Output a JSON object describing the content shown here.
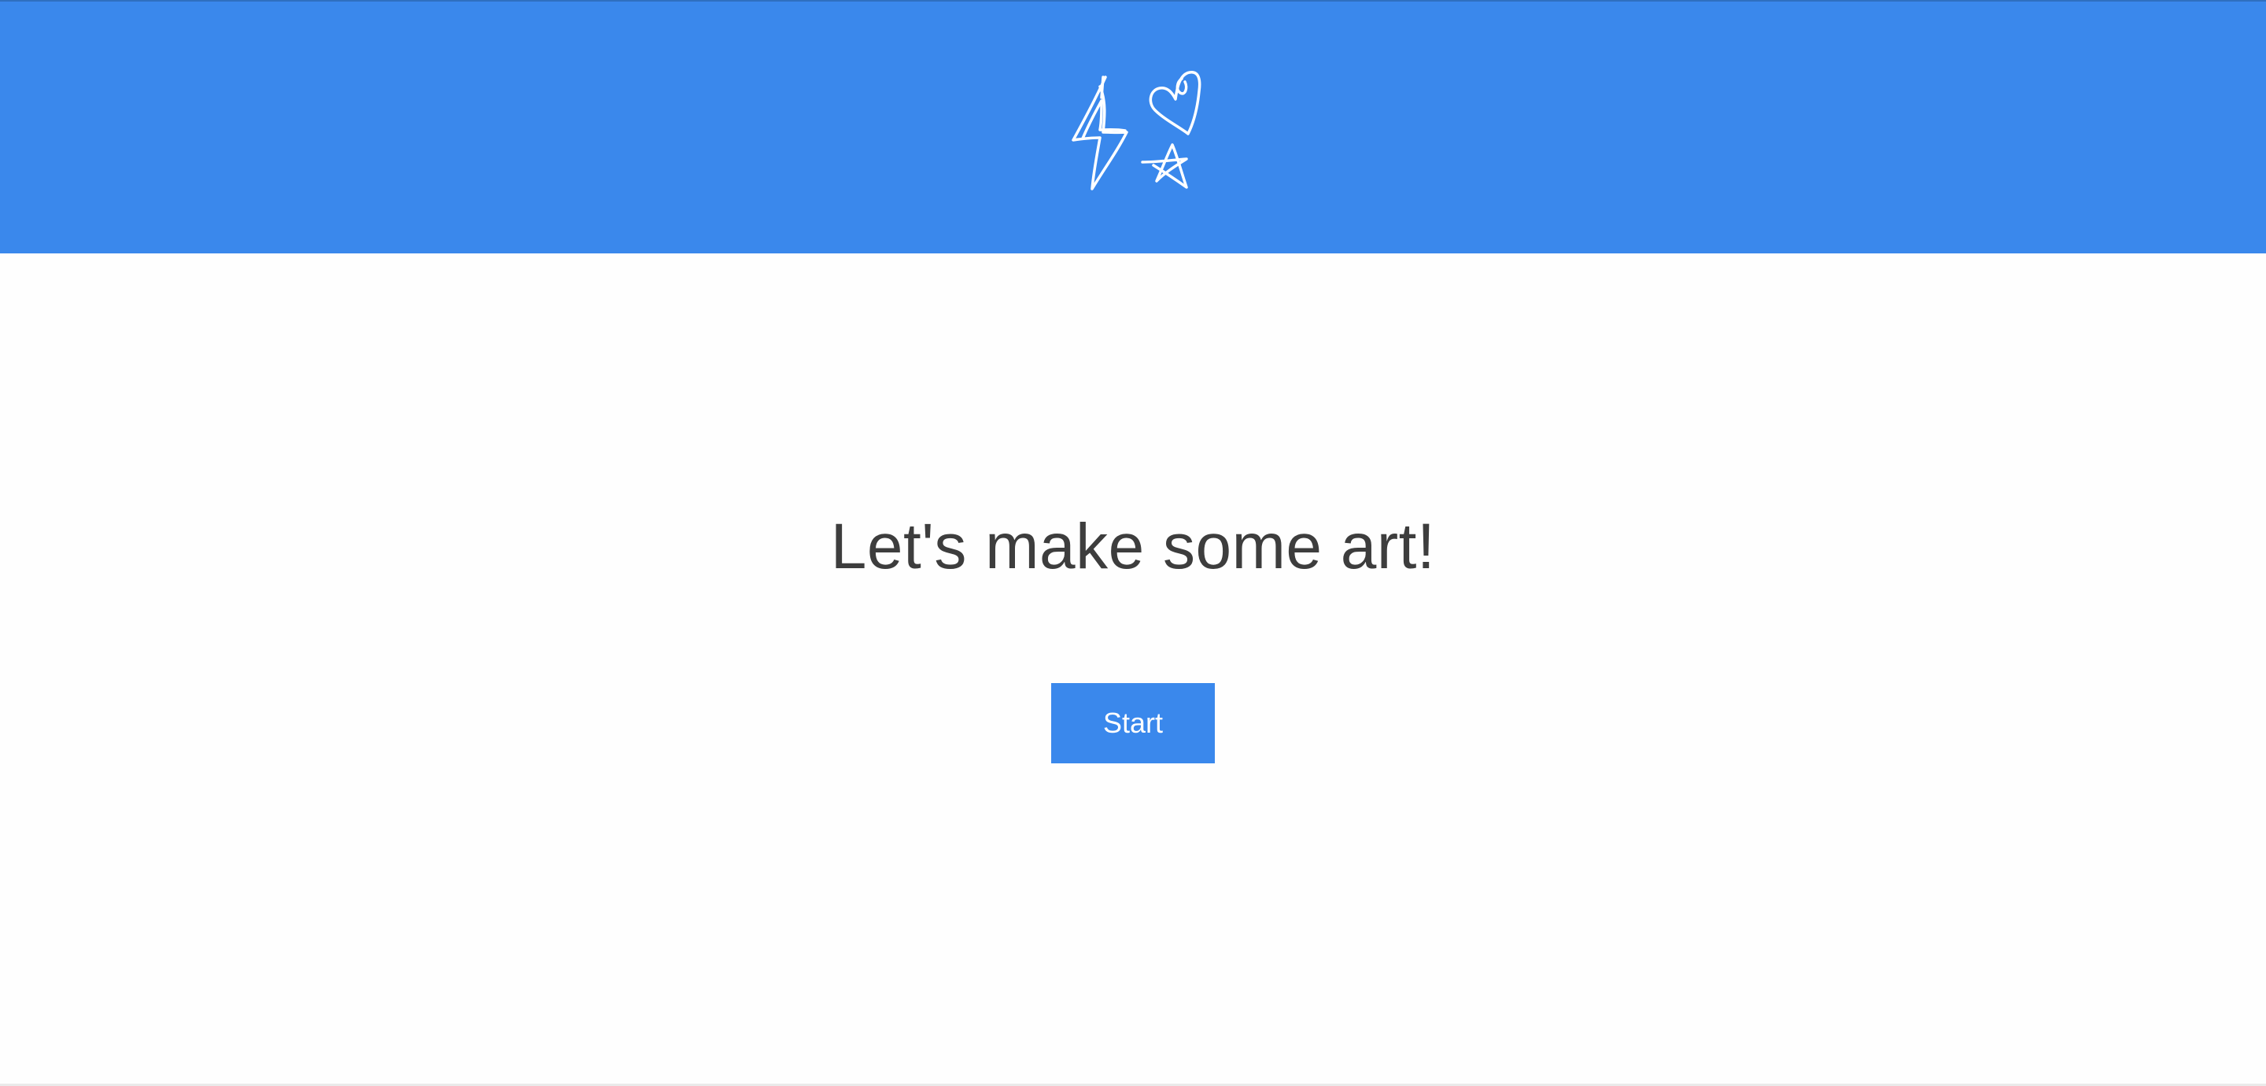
{
  "header": {
    "logo_icons": [
      "lightning-icon",
      "heart-icon",
      "star-icon"
    ],
    "background_color": "#3a88ec"
  },
  "main": {
    "headline": "Let's make some art!",
    "start_button_label": "Start",
    "text_color": "#3d3d3d",
    "button_color": "#3a88ec"
  }
}
